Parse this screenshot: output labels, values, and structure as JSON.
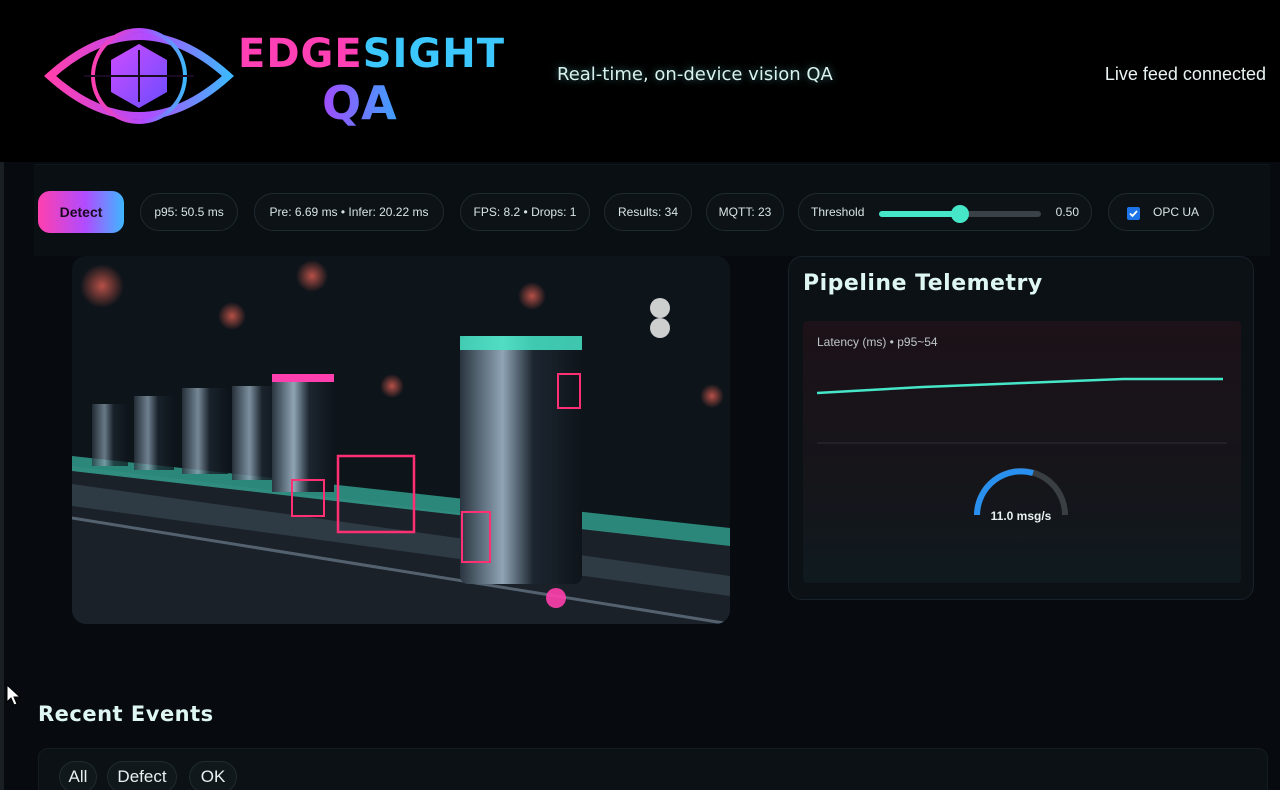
{
  "header": {
    "brand_part1": "EDGE",
    "brand_part2": "SIGHT",
    "brand_line2": "QA",
    "tagline": "Real-time, on-device vision QA",
    "connection_status": "Live feed connected"
  },
  "toolbar": {
    "detect_label": "Detect",
    "p95": "p95: 50.5 ms",
    "timing": "Pre: 6.69 ms • Infer: 20.22 ms",
    "fps": "FPS: 8.2 • Drops: 1",
    "results": "Results: 34",
    "mqtt": "MQTT: 23",
    "threshold_label": "Threshold",
    "threshold_value": "0.50",
    "threshold_fraction": 0.5,
    "opc_label": "OPC UA",
    "opc_checked": true
  },
  "telemetry": {
    "title": "Pipeline Telemetry",
    "latency_label": "Latency (ms) • p95~54",
    "gauge_label": "11.0 msg/s"
  },
  "events": {
    "title": "Recent Events",
    "filters": [
      "All",
      "Defect",
      "OK"
    ]
  },
  "colors": {
    "accent_pink": "#ff3fb4",
    "accent_cyan": "#46e6c8",
    "accent_blue": "#3cc7ff",
    "checkbox_blue": "#1c74e8"
  },
  "icons": {
    "logo": "eye-crosshair-hexagon-icon",
    "cursor": "mouse-pointer-icon",
    "checkbox": "checkmark-icon"
  }
}
